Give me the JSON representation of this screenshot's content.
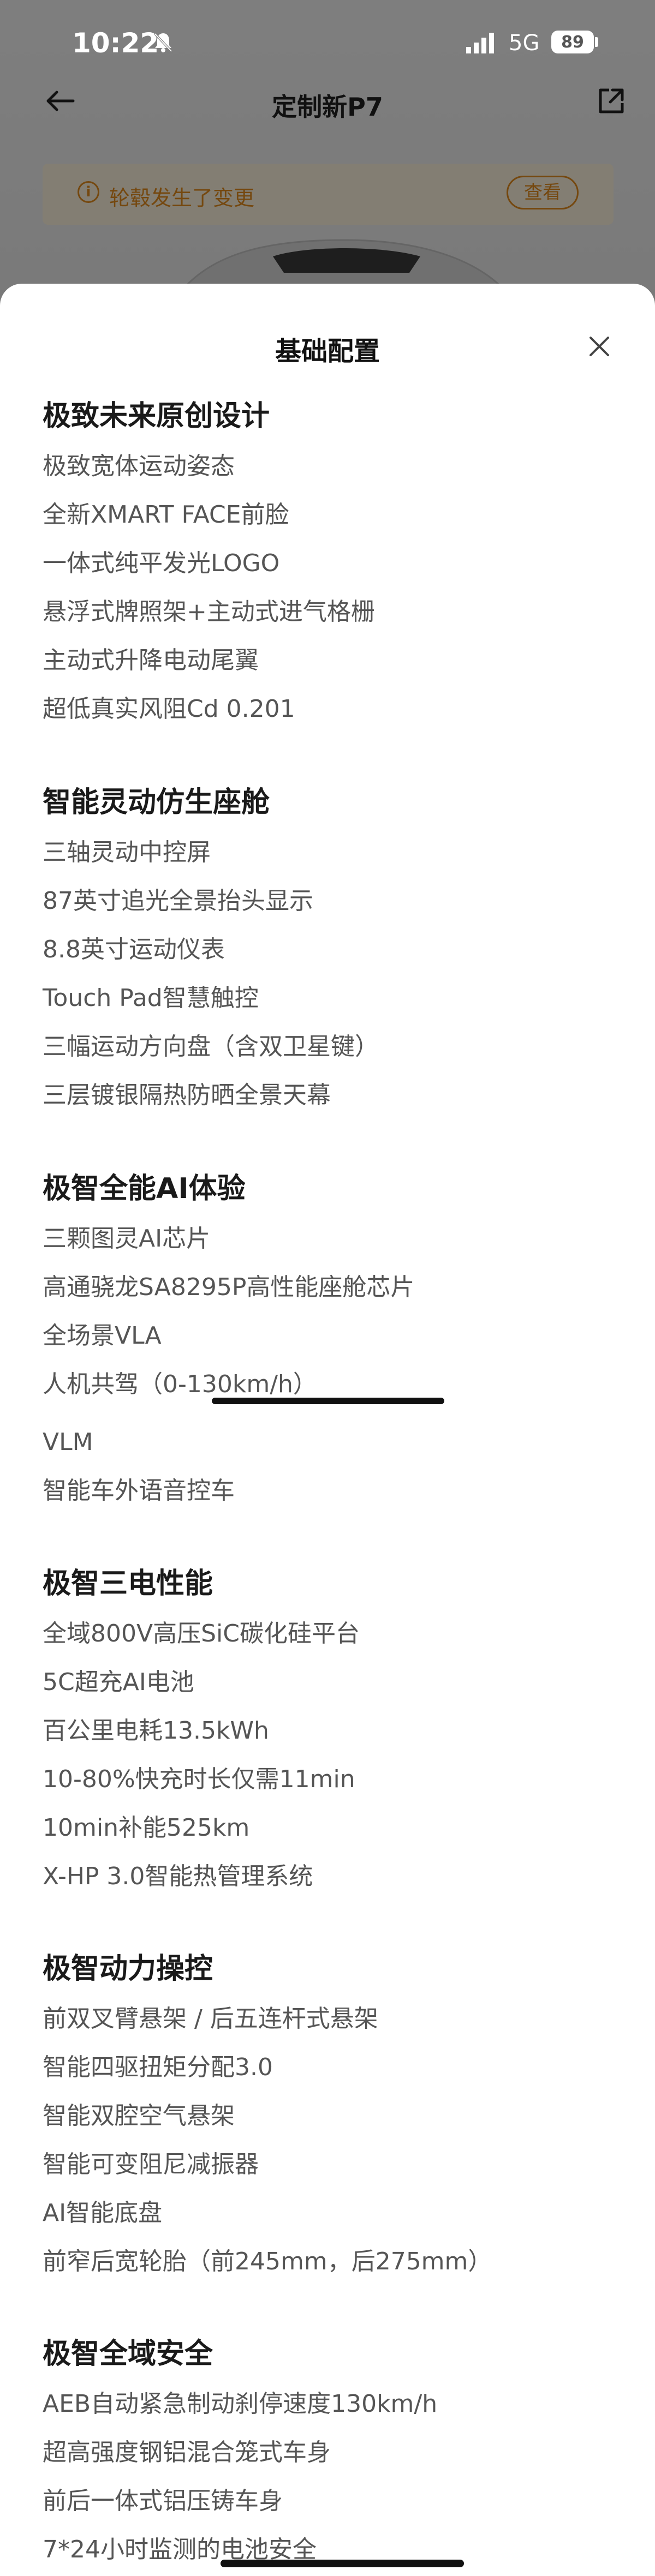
{
  "status_bar": {
    "time": "10:22",
    "network": "5G",
    "battery": "89"
  },
  "nav": {
    "title": "定制新P7"
  },
  "notice": {
    "text": "轮毂发生了变更",
    "button_label": "查看"
  },
  "sheet": {
    "title": "基础配置",
    "sections": [
      {
        "title": "极致未来原创设计",
        "items": [
          "极致宽体运动姿态",
          "全新XMART FACE前脸",
          "一体式纯平发光LOGO",
          "悬浮式牌照架+主动式进气格栅",
          "主动式升降电动尾翼",
          "超低真实风阻Cd 0.201"
        ]
      },
      {
        "title": "智能灵动仿生座舱",
        "items": [
          "三轴灵动中控屏",
          "87英寸追光全景抬头显示",
          "8.8英寸运动仪表",
          "Touch Pad智慧触控",
          "三幅运动方向盘（含双卫星键）",
          "三层镀银隔热防晒全景天幕"
        ]
      },
      {
        "title": "极智全能AI体验",
        "items": [
          "三颗图灵AI芯片",
          "高通骁龙SA8295P高性能座舱芯片",
          "全场景VLA",
          "人机共驾（0-130km/h）",
          "VLM",
          "智能车外语音控车"
        ]
      },
      {
        "title": "极智三电性能",
        "items": [
          "全域800V高压SiC碳化硅平台",
          "5C超充AI电池",
          "百公里电耗13.5kWh",
          "10-80%快充时长仅需11min",
          "10min补能525km",
          "X-HP 3.0智能热管理系统"
        ]
      },
      {
        "title": "极智动力操控",
        "items": [
          "前双叉臂悬架 / 后五连杆式悬架",
          "智能四驱扭矩分配3.0",
          "智能双腔空气悬架",
          "智能可变阻尼减振器",
          "AI智能底盘",
          "前窄后宽轮胎（前245mm，后275mm）"
        ]
      },
      {
        "title": "极智全域安全",
        "items": [
          "AEB自动紧急制动刹停速度130km/h",
          "超高强度钢铝混合笼式车身",
          "前后一体式铝压铸车身",
          "7*24小时监测的电池安全"
        ]
      }
    ]
  },
  "colors": {
    "accent": "#e08a1e",
    "notice_bg": "#fbf1dd",
    "scrim": "rgba(0,0,0,0.48)"
  }
}
